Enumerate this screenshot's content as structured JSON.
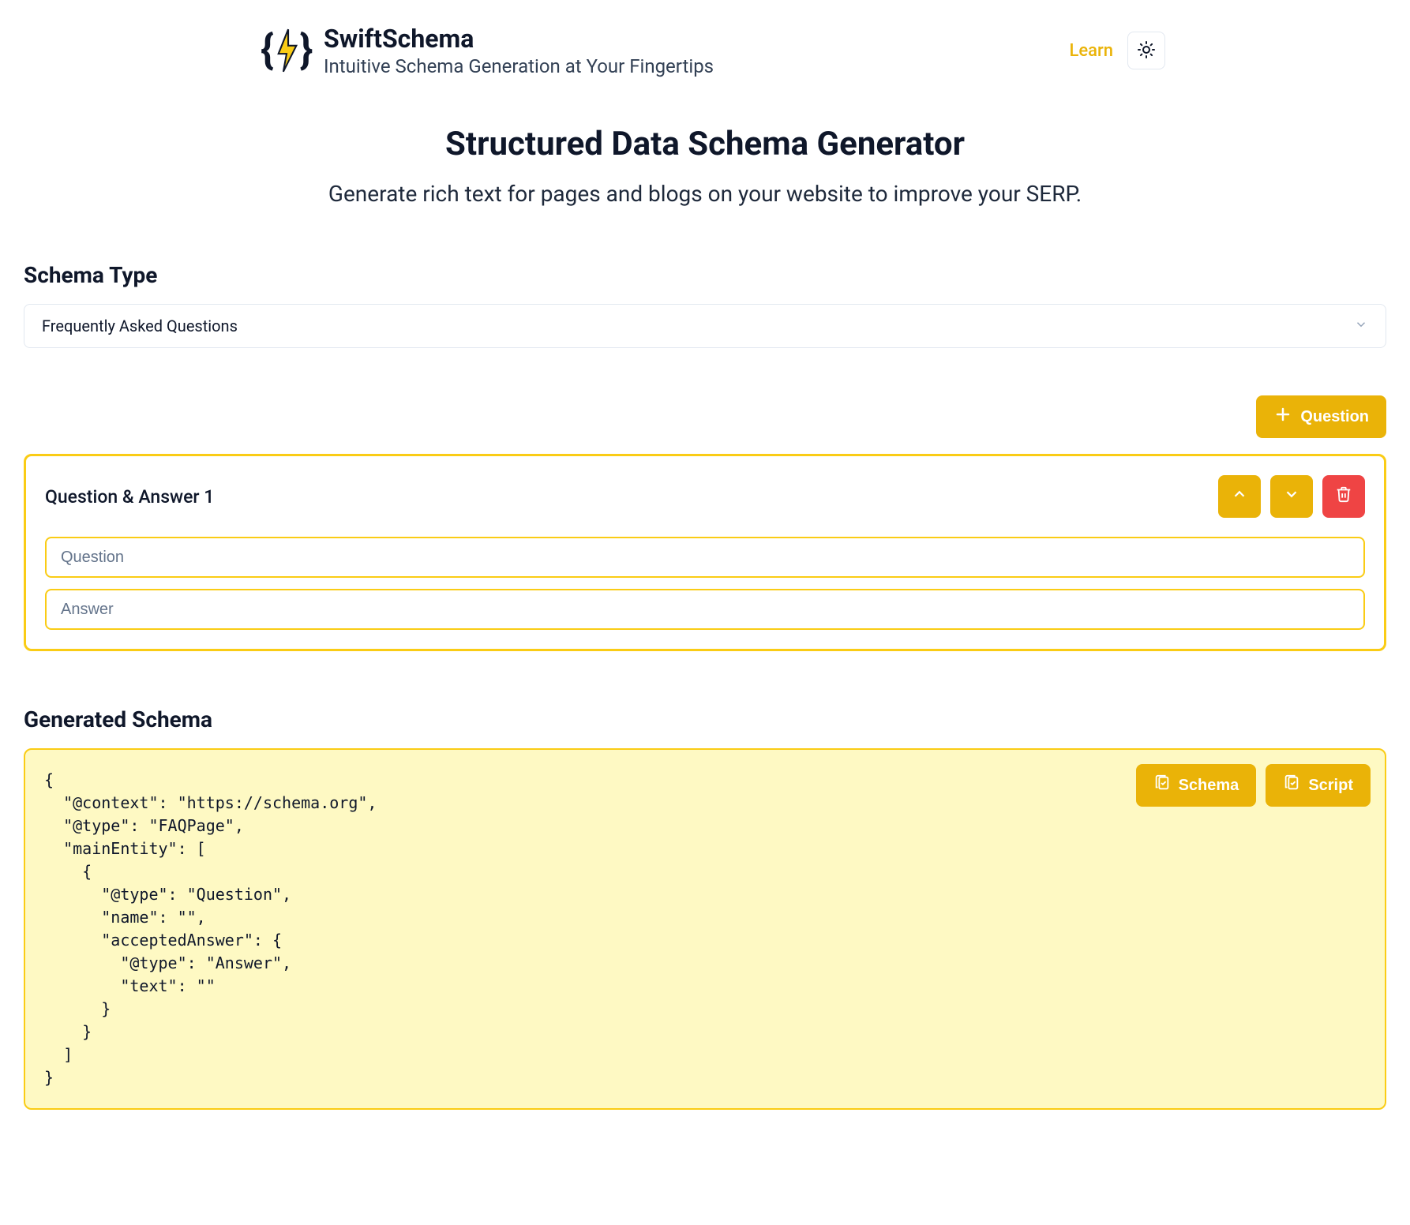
{
  "header": {
    "brand_title": "SwiftSchema",
    "brand_subtitle": "Intuitive Schema Generation at Your Fingertips",
    "learn_label": "Learn"
  },
  "hero": {
    "title": "Structured Data Schema Generator",
    "subtitle": "Generate rich text for pages and blogs on your website to improve your SERP."
  },
  "schema_type": {
    "label": "Schema Type",
    "selected": "Frequently Asked Questions"
  },
  "add_question_label": "Question",
  "qa": {
    "title": "Question & Answer 1",
    "question_placeholder": "Question",
    "answer_placeholder": "Answer",
    "question_value": "",
    "answer_value": ""
  },
  "generated": {
    "label": "Generated Schema",
    "copy_schema_label": "Schema",
    "copy_script_label": "Script",
    "code": "{\n  \"@context\": \"https://schema.org\",\n  \"@type\": \"FAQPage\",\n  \"mainEntity\": [\n    {\n      \"@type\": \"Question\",\n      \"name\": \"\",\n      \"acceptedAnswer\": {\n        \"@type\": \"Answer\",\n        \"text\": \"\"\n      }\n    }\n  ]\n}"
  },
  "colors": {
    "accent": "#eab308",
    "accent_light": "#facc15",
    "danger": "#ef4444",
    "code_bg": "#fef9c3"
  }
}
